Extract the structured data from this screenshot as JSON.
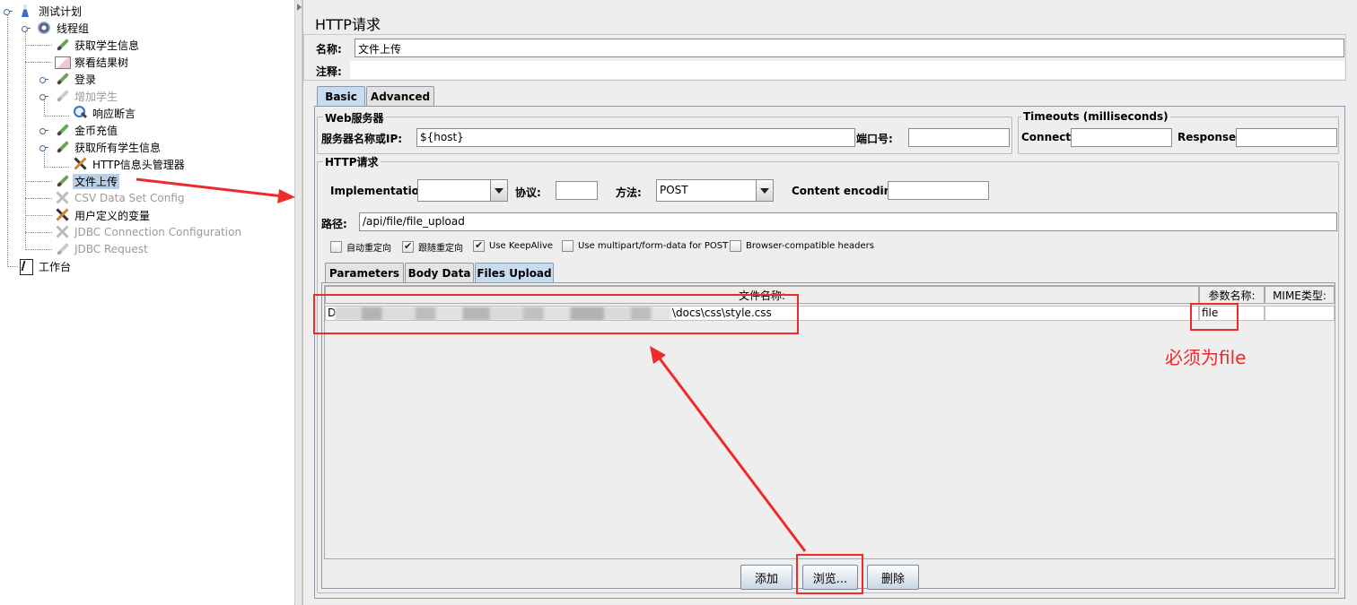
{
  "tree": {
    "nodes": [
      {
        "label": "测试计划",
        "icon": "flask-icon"
      },
      {
        "label": "线程组",
        "icon": "gear-icon"
      },
      {
        "label": "获取学生信息",
        "icon": "pipette-icon"
      },
      {
        "label": "察看结果树",
        "icon": "graph-icon"
      },
      {
        "label": "登录",
        "icon": "pipette-icon"
      },
      {
        "label": "增加学生",
        "icon": "pipette-icon",
        "disabled": true
      },
      {
        "label": "响应断言",
        "icon": "magnifier-icon"
      },
      {
        "label": "金币充值",
        "icon": "pipette-icon"
      },
      {
        "label": "获取所有学生信息",
        "icon": "pipette-icon"
      },
      {
        "label": "HTTP信息头管理器",
        "icon": "wrench-icon"
      },
      {
        "label": "文件上传",
        "icon": "pipette-icon",
        "selected": true
      },
      {
        "label": "CSV Data Set Config",
        "icon": "wrench-icon",
        "disabled": true
      },
      {
        "label": "用户定义的变量",
        "icon": "wrench-icon"
      },
      {
        "label": "JDBC Connection Configuration",
        "icon": "wrench-icon",
        "disabled": true
      },
      {
        "label": "JDBC Request",
        "icon": "pipette-icon",
        "disabled": true
      },
      {
        "label": "工作台",
        "icon": "book-icon"
      }
    ]
  },
  "panel": {
    "title": "HTTP请求",
    "name_label": "名称:",
    "name_value": "文件上传",
    "comment_label": "注释:",
    "comment_value": "",
    "tabs": [
      "Basic",
      "Advanced"
    ],
    "web_server": {
      "legend": "Web服务器",
      "server_label": "服务器名称或IP:",
      "server_value": "${host}",
      "port_label": "端口号:",
      "port_value": ""
    },
    "timeouts": {
      "legend": "Timeouts (milliseconds)",
      "connect_label": "Connect:",
      "connect_value": "",
      "response_label": "Response:",
      "response_value": ""
    },
    "http_request": {
      "legend": "HTTP请求",
      "implementation_label": "Implementation:",
      "implementation_value": "",
      "protocol_label": "协议:",
      "protocol_value": "",
      "method_label": "方法:",
      "method_value": "POST",
      "encoding_label": "Content encoding:",
      "encoding_value": "",
      "path_label": "路径:",
      "path_value": "/api/file/file_upload"
    },
    "checkboxes": [
      {
        "label": "自动重定向",
        "checked": false
      },
      {
        "label": "跟随重定向",
        "checked": true
      },
      {
        "label": "Use KeepAlive",
        "checked": true
      },
      {
        "label": "Use multipart/form-data for POST",
        "checked": false
      },
      {
        "label": "Browser-compatible headers",
        "checked": false
      }
    ],
    "sub_tabs": [
      "Parameters",
      "Body Data",
      "Files Upload"
    ],
    "files_table": {
      "columns": [
        "文件名称:",
        "参数名称:",
        "MIME类型:"
      ],
      "rows": [
        {
          "file_prefix": "D",
          "file_suffix": "\\docs\\css\\style.css",
          "param": "file",
          "mime": ""
        }
      ]
    },
    "buttons": {
      "add": "添加",
      "browse": "浏览...",
      "delete": "删除"
    }
  },
  "annotation": {
    "note": "必须为file",
    "color": "#ee2a2a"
  }
}
